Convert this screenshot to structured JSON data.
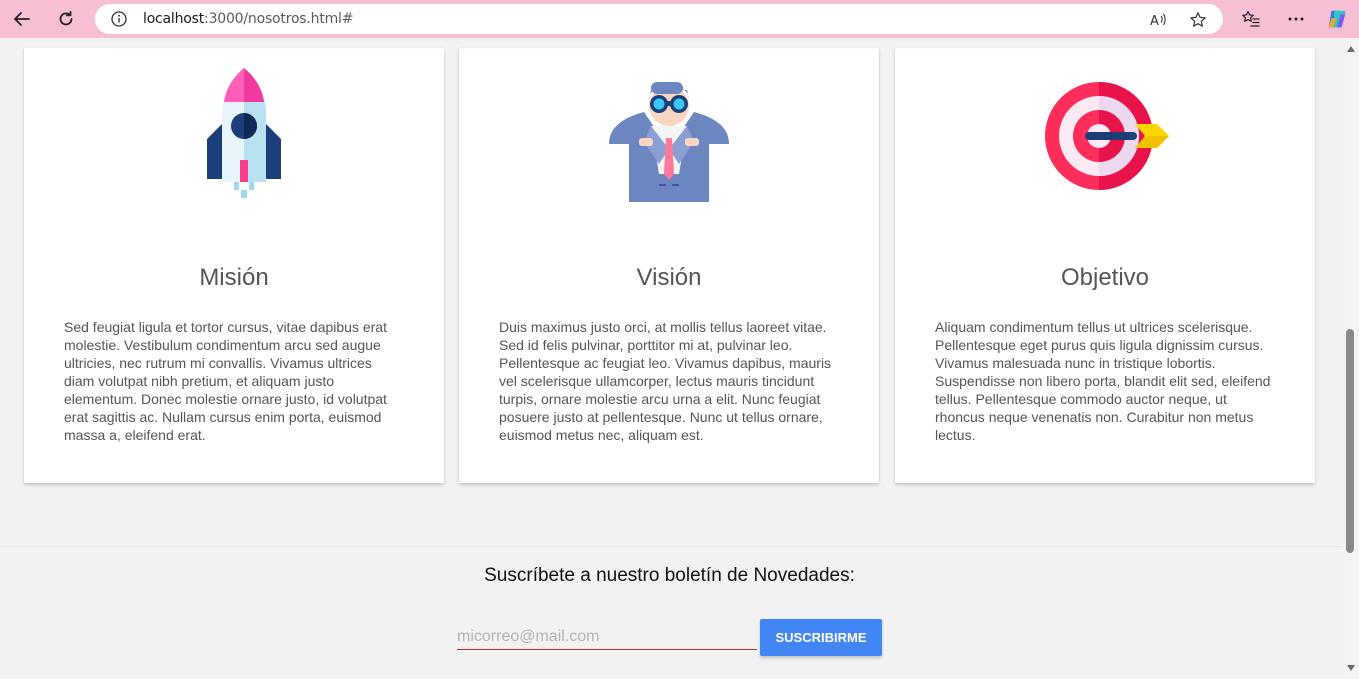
{
  "browser": {
    "url_host": "localhost",
    "url_path": ":3000/nosotros.html#",
    "icons": [
      "back-arrow-icon",
      "refresh-icon",
      "info-icon",
      "read-aloud-icon",
      "favorite-star-icon",
      "favorites-icon",
      "more-icon",
      "copilot-icon"
    ]
  },
  "cards": [
    {
      "title": "Misión",
      "text": "Sed feugiat ligula et tortor cursus, vitae dapibus erat molestie. Vestibulum condimentum arcu sed augue ultricies, nec rutrum mi convallis. Vivamus ultrices diam volutpat nibh pretium, et aliquam justo elementum. Donec molestie ornare justo, id volutpat erat sagittis ac. Nullam cursus enim porta, euismod massa a, eleifend erat.",
      "icon": "rocket-icon"
    },
    {
      "title": "Visión",
      "text": "Duis maximus justo orci, at mollis tellus laoreet vitae. Sed id felis pulvinar, porttitor mi at, pulvinar leo. Pellentesque ac feugiat leo. Vivamus dapibus, mauris vel scelerisque ullamcorper, lectus mauris tincidunt turpis, ornare molestie arcu urna a elit. Nunc feugiat posuere justo at pellentesque. Nunc ut tellus ornare, euismod metus nec, aliquam est.",
      "icon": "binoculars-man-icon"
    },
    {
      "title": "Objetivo",
      "text": "Aliquam condimentum tellus ut ultrices scelerisque. Pellentesque eget purus quis ligula dignissim cursus. Vivamus malesuada nunc in tristique lobortis. Suspendisse non libero porta, blandit elit sed, eleifend tellus. Pellentesque commodo auctor neque, ut rhoncus neque venenatis non. Curabitur non metus lectus.",
      "icon": "target-dart-icon"
    }
  ],
  "newsletter": {
    "title": "Suscríbete a nuestro boletín de Novedades:",
    "email_placeholder": "micorreo@mail.com",
    "email_value": "",
    "button_label": "SUSCRIBIRME"
  },
  "colors": {
    "chrome": "#f7bfd3",
    "button": "#4285f4",
    "input_underline": "#c62828"
  }
}
